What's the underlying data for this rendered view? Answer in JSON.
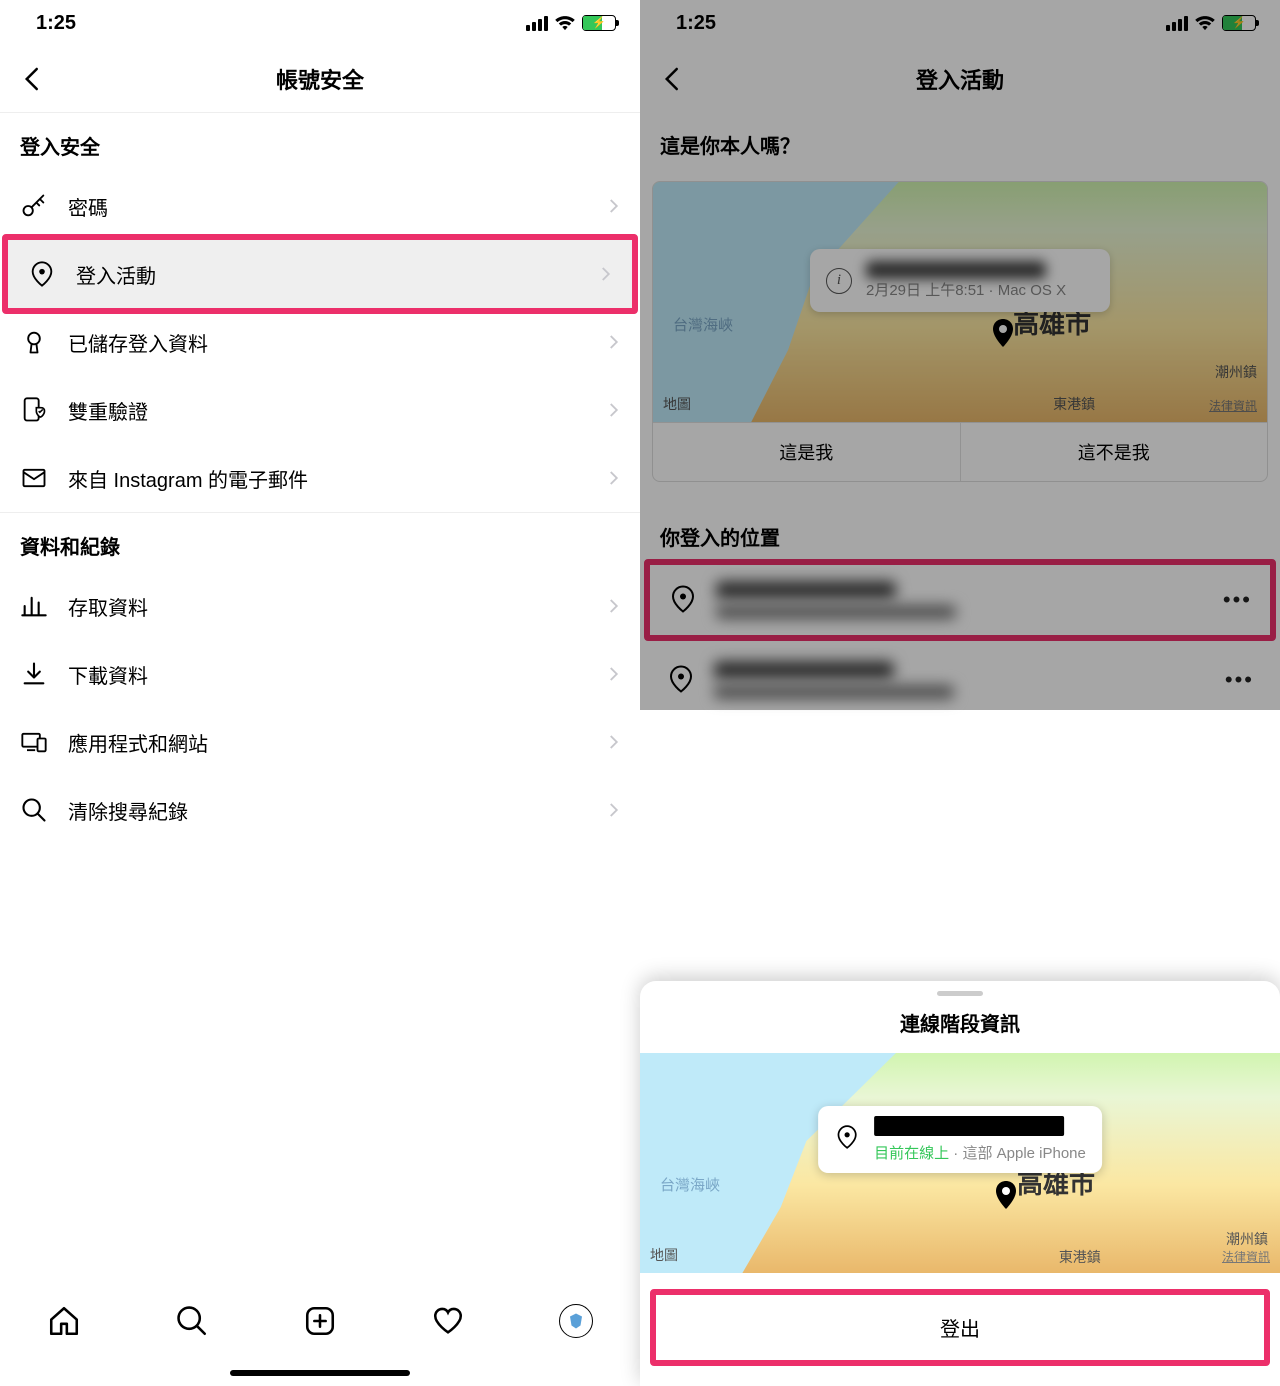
{
  "colors": {
    "highlight": "#ec2f6a",
    "green": "#34c759"
  },
  "status": {
    "time": "1:25"
  },
  "left": {
    "title": "帳號安全",
    "section1_title": "登入安全",
    "section2_title": "資料和紀錄",
    "items1": {
      "password": "密碼",
      "login_activity": "登入活動",
      "saved_login": "已儲存登入資料",
      "two_factor": "雙重驗證",
      "emails": "來自 Instagram 的電子郵件"
    },
    "items2": {
      "access_data": "存取資料",
      "download_data": "下載資料",
      "apps_sites": "應用程式和網站",
      "clear_history": "清除搜尋紀錄"
    }
  },
  "right": {
    "title": "登入活動",
    "question": "這是你本人嗎？",
    "map": {
      "sea_label": "台灣海峽",
      "city": "高雄市",
      "town1": "潮州鎮",
      "town2": "東港鎮",
      "apple_maps": "地圖",
      "legal": "法律資訊"
    },
    "info_sub": "2月29日 上午8:51 · Mac OS X",
    "btn_yes": "這是我",
    "btn_no": "這不是我",
    "where_title": "你登入的位置",
    "sheet": {
      "title": "連線階段資訊",
      "online": "目前在線上",
      "device": " · 這部 Apple iPhone",
      "logout": "登出"
    }
  }
}
